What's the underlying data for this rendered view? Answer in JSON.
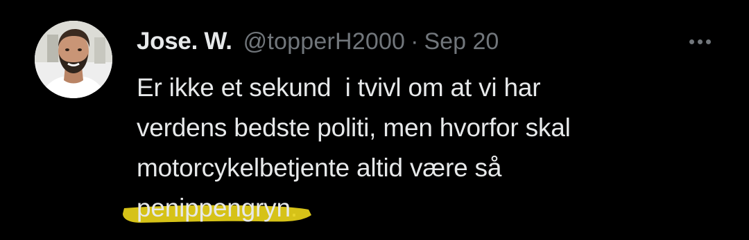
{
  "tweet": {
    "author": {
      "display_name": "Jose. W.",
      "handle": "@topperH2000",
      "avatar_icon": "profile-photo-icon"
    },
    "separator": "·",
    "timestamp": "Sep 20",
    "more_icon": "more-options-icon",
    "text_lines": [
      "Er ikke et sekund  i tvivl om at vi har",
      "verdens bedste politi, men hvorfor skal",
      "motorcykelbetjente altid være så"
    ],
    "highlighted_word": "penippengryn",
    "final_punctuation": ".",
    "colors": {
      "background": "#000000",
      "primary_text": "#e7e9ea",
      "secondary_text": "#71767b",
      "highlighter": "#e8d21a"
    }
  }
}
